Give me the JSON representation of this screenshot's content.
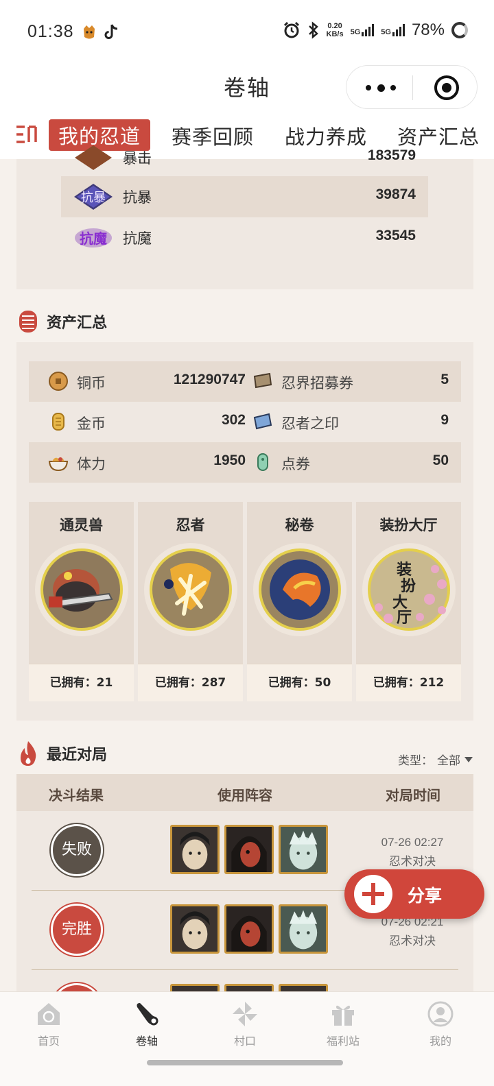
{
  "status_bar": {
    "time": "01:38",
    "net_speed_value": "0.20",
    "net_speed_unit": "KB/s",
    "sim1": "5G",
    "sim2": "5G",
    "battery": "78%"
  },
  "header": {
    "title": "卷轴"
  },
  "tabs": [
    {
      "label": "我的忍道",
      "active": true
    },
    {
      "label": "赛季回顾"
    },
    {
      "label": "战力养成"
    },
    {
      "label": "资产汇总"
    }
  ],
  "stats": {
    "partial_label": "暴击",
    "partial_value": "183579",
    "rows": [
      {
        "badge": "抗暴",
        "label": "抗暴",
        "value": "39874"
      },
      {
        "badge": "抗魔",
        "label": "抗魔",
        "value": "33545"
      }
    ]
  },
  "assets": {
    "title": "资产汇总",
    "rows": [
      {
        "left_label": "铜币",
        "left_value": "121290747",
        "right_label": "忍界招募券",
        "right_value": "5"
      },
      {
        "left_label": "金币",
        "left_value": "302",
        "right_label": "忍者之印",
        "right_value": "9"
      },
      {
        "left_label": "体力",
        "left_value": "1950",
        "right_label": "点券",
        "right_value": "50"
      }
    ],
    "collections": [
      {
        "title": "通灵兽",
        "owned": "已拥有：21"
      },
      {
        "title": "忍者",
        "owned": "已拥有：287"
      },
      {
        "title": "秘卷",
        "owned": "已拥有：50"
      },
      {
        "title": "装扮大厅",
        "owned": "已拥有：212"
      }
    ],
    "costume_art_text": "装扮大厅"
  },
  "recent": {
    "title": "最近对局",
    "filter_label": "类型：",
    "filter_value": "全部",
    "columns": [
      "决斗结果",
      "使用阵容",
      "对局时间"
    ],
    "matches": [
      {
        "result": "失败",
        "time": "07-26 02:27",
        "mode": "忍术对决"
      },
      {
        "result": "完胜",
        "time": "07-26 02:21",
        "mode": "忍术对决"
      }
    ]
  },
  "share": {
    "label": "分享"
  },
  "bottom_nav": [
    {
      "label": "首页",
      "icon": "home-icon"
    },
    {
      "label": "卷轴",
      "icon": "scroll-icon",
      "active": true
    },
    {
      "label": "村口",
      "icon": "pinwheel-icon"
    },
    {
      "label": "福利站",
      "icon": "gift-icon"
    },
    {
      "label": "我的",
      "icon": "profile-icon"
    }
  ],
  "colors": {
    "accent": "#c94a3f",
    "card_bg": "#efe8e2",
    "row_shade": "#e6dbd1",
    "lose": "#5b5249"
  }
}
